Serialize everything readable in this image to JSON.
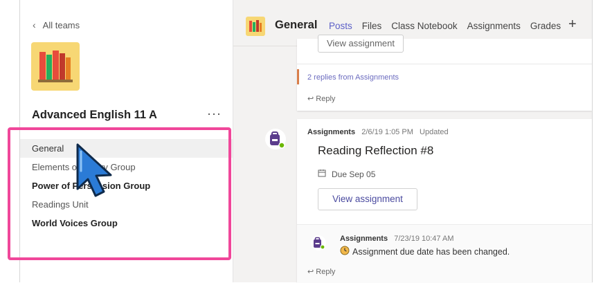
{
  "left": {
    "back_label": "All teams",
    "team_name": "Advanced English 11 A",
    "more_label": "···",
    "channels": [
      {
        "label": "General",
        "bold": false,
        "active": true
      },
      {
        "label": "Elements of Poetry Group",
        "bold": false,
        "active": false
      },
      {
        "label": "Power of Persuasion Group",
        "bold": true,
        "active": false
      },
      {
        "label": "Readings Unit",
        "bold": false,
        "active": false
      },
      {
        "label": "World Voices Group",
        "bold": true,
        "active": false
      }
    ]
  },
  "header": {
    "channel_title": "General",
    "tabs": [
      "Posts",
      "Files",
      "Class Notebook",
      "Assignments",
      "Grades"
    ],
    "active_tab": "Posts",
    "add_tab": "+"
  },
  "feed": {
    "post1": {
      "button_label": "View assignment",
      "replies_text": "2 replies from Assignments",
      "reply_label": "Reply"
    },
    "post2": {
      "author": "Assignments",
      "timestamp": "2/6/19 1:05 PM",
      "status": "Updated",
      "title": "Reading Reflection #8",
      "due": "Due Sep 05",
      "button_label": "View assignment",
      "sub_author": "Assignments",
      "sub_timestamp": "7/23/19 10:47 AM",
      "sub_text": "Assignment due date has been changed.",
      "reply_label": "Reply"
    }
  },
  "colors": {
    "accent": "#5b5fc7",
    "highlight": "#f0479a",
    "assignments_purple": "#6b3fa0"
  }
}
